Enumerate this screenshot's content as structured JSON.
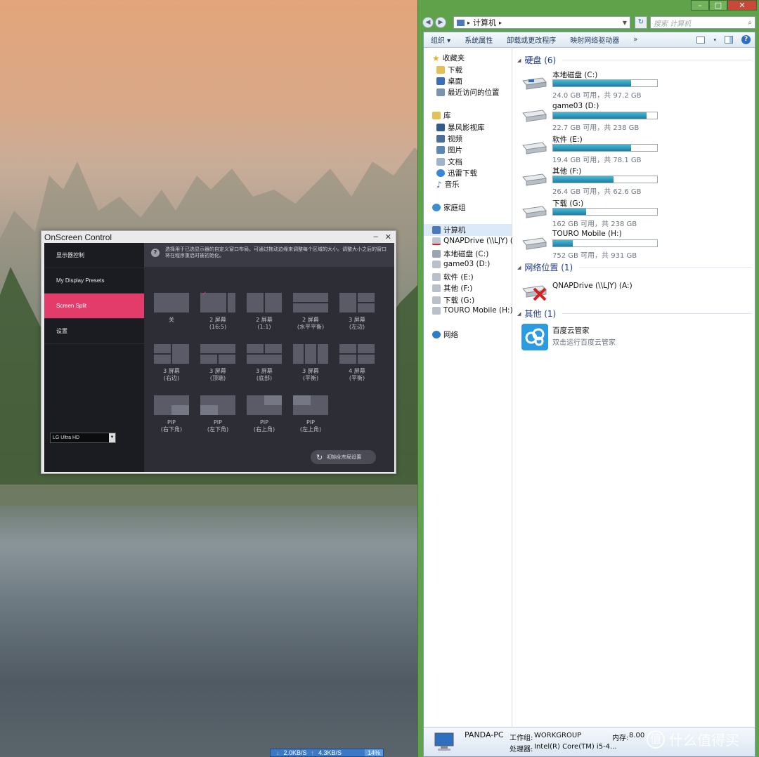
{
  "osc": {
    "title": "OnScreen Control",
    "min": "–",
    "close": "✕",
    "sidebar": [
      {
        "label": "显示器控制",
        "active": false
      },
      {
        "label": "My Display Presets",
        "active": false
      },
      {
        "label": "Screen Split",
        "active": true
      },
      {
        "label": "设置",
        "active": false
      }
    ],
    "monitor_select": "LG Ultra HD",
    "info_text": "选择用于已选显示器的自定义窗口布局。可通过拖动边缘来调整每个区域的大小。调整大小之后的窗口将在程序重启时被初始化。",
    "layouts": [
      {
        "l1": "关",
        "l2": ""
      },
      {
        "l1": "2 屏幕",
        "l2": "(16:5)",
        "selected": true
      },
      {
        "l1": "2 屏幕",
        "l2": "(1:1)"
      },
      {
        "l1": "2 屏幕",
        "l2": "(水平平衡)"
      },
      {
        "l1": "3 屏幕",
        "l2": "(左边)"
      },
      {
        "l1": "3 屏幕",
        "l2": "(右边)"
      },
      {
        "l1": "3 屏幕",
        "l2": "(顶端)"
      },
      {
        "l1": "3 屏幕",
        "l2": "(底部)"
      },
      {
        "l1": "3 屏幕",
        "l2": "(平衡)"
      },
      {
        "l1": "4 屏幕",
        "l2": "(平衡)"
      },
      {
        "l1": "PIP",
        "l2": "(右下角)"
      },
      {
        "l1": "PIP",
        "l2": "(左下角)"
      },
      {
        "l1": "PIP",
        "l2": "(右上角)"
      },
      {
        "l1": "PIP",
        "l2": "(左上角)"
      }
    ],
    "reset_label": "初始化布局设置"
  },
  "explorer": {
    "address": "计算机",
    "search_placeholder": "搜索 计算机",
    "toolbar": {
      "organize": "组织 ▾",
      "sysprops": "系统属性",
      "uninstall": "卸载或更改程序",
      "mapdrive": "映射网络驱动器",
      "more": "»"
    },
    "nav": {
      "favorites": "收藏夹",
      "fav_items": [
        "下载",
        "桌面",
        "最近访问的位置"
      ],
      "libraries": "库",
      "lib_items": [
        "暴风影视库",
        "视频",
        "图片",
        "文档",
        "迅雷下载",
        "音乐"
      ],
      "homegroup": "家庭组",
      "computer": "计算机",
      "comp_items": [
        "QNAPDrive (\\\\LJY) (",
        "本地磁盘 (C:)",
        "game03 (D:)",
        "软件 (E:)",
        "其他 (F:)",
        "下载 (G:)",
        "TOURO Mobile (H:)"
      ],
      "network": "网络"
    },
    "groups": {
      "hdd": "硬盘 (6)",
      "netloc": "网络位置 (1)",
      "other": "其他 (1)"
    },
    "drives": [
      {
        "name": "本地磁盘 (C:)",
        "free": "24.0 GB 可用，共 97.2 GB",
        "used_pct": 75
      },
      {
        "name": "game03 (D:)",
        "free": "22.7 GB 可用，共 238 GB",
        "used_pct": 90
      },
      {
        "name": "软件 (E:)",
        "free": "19.4 GB 可用，共 78.1 GB",
        "used_pct": 75
      },
      {
        "name": "其他 (F:)",
        "free": "26.4 GB 可用，共 62.6 GB",
        "used_pct": 58
      },
      {
        "name": "下载 (G:)",
        "free": "162 GB 可用，共 238 GB",
        "used_pct": 32
      },
      {
        "name": "TOURO Mobile (H:)",
        "free": "752 GB 可用，共 931 GB",
        "used_pct": 19
      }
    ],
    "netdrive": "QNAPDrive (\\\\LJY) (A:)",
    "other_item": {
      "name": "百度云管家",
      "desc": "双击运行百度云管家"
    },
    "details": {
      "pcname": "PANDA-PC",
      "workgroup_label": "工作组:",
      "workgroup": "WORKGROUP",
      "mem_label": "内存:",
      "mem": "8.00",
      "cpu_label": "处理器:",
      "cpu": "Intel(R) Core(TM) i5-4..."
    }
  },
  "netmeter": {
    "down": "2.0KB/S",
    "up": "4.3KB/S",
    "cpu": "14%"
  },
  "watermark": "什么值得买",
  "colors": {
    "accent": "#e33c6b",
    "drive_bar": "#1c7fa4"
  }
}
